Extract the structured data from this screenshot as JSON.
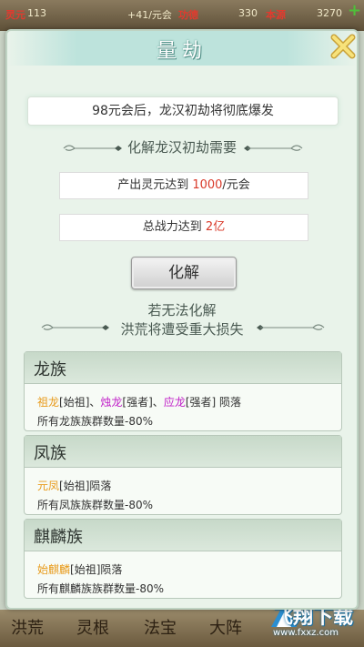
{
  "topbar": {
    "lingyuan_label": "灵元",
    "lingyuan_value": "113",
    "rate": "+41/元会",
    "gongde_label": "功德",
    "gongde_value": "330",
    "benyuan_label": "本源",
    "benyuan_value": "3270"
  },
  "bottom_nav": [
    "洪荒",
    "灵根",
    "法宝",
    "大阵"
  ],
  "watermark": {
    "title": "飞翔下载",
    "url": "www.fxxz.com"
  },
  "dialog": {
    "title": "量劫",
    "banner": "98元会后，龙汉初劫将彻底爆发",
    "resolve_heading": "化解龙汉初劫需要",
    "req1": {
      "prefix": "产出灵元达到 ",
      "value": "1000",
      "suffix": "/元会"
    },
    "req2": {
      "prefix": "总战力达到 ",
      "value": "2亿"
    },
    "resolve_button": "化解",
    "warning_line1": "若无法化解",
    "warning_line2": "洪荒将遭受重大损失"
  },
  "clans": [
    {
      "name": "龙族",
      "members": [
        {
          "name": "祖龙",
          "rank": "[始祖]",
          "sep": "、",
          "color": "#e89b1c"
        },
        {
          "name": "烛龙",
          "rank": "[强者]",
          "sep": "、",
          "color": "#c020c8"
        },
        {
          "name": "应龙",
          "rank": "[强者]",
          "sep": " ",
          "color": "#c020c8"
        }
      ],
      "fate": "陨落",
      "effect": "所有龙族族群数量-80%"
    },
    {
      "name": "凤族",
      "members": [
        {
          "name": "元凤",
          "rank": "[始祖]",
          "sep": "",
          "color": "#e89b1c"
        }
      ],
      "fate": "陨落",
      "effect": "所有凤族族群数量-80%"
    },
    {
      "name": "麒麟族",
      "members": [
        {
          "name": "始麒麟",
          "rank": "[始祖]",
          "sep": "",
          "color": "#e89b1c"
        }
      ],
      "fate": "陨落",
      "effect": "所有麒麟族族群数量-80%"
    }
  ],
  "colors": {
    "accent_red": "#d93a2a",
    "founder": "#e89b1c",
    "strong": "#c020c8",
    "close_icon": "#f3d35a"
  }
}
